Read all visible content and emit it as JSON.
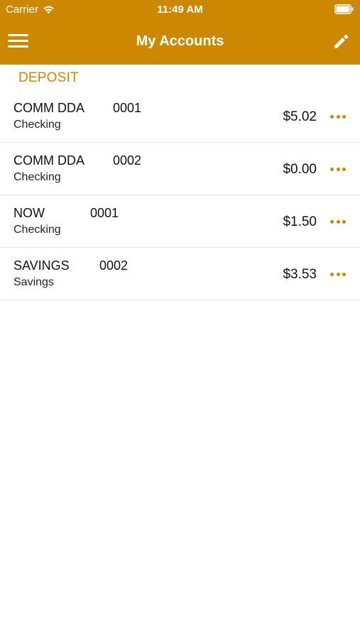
{
  "status_bar": {
    "carrier": "Carrier",
    "time": "11:49 AM"
  },
  "nav": {
    "title": "My Accounts",
    "menu_icon": "hamburger-menu-icon",
    "edit_icon": "pencil-icon"
  },
  "section": {
    "title": "DEPOSIT"
  },
  "accounts": [
    {
      "name": "COMM DDA",
      "number": "0001",
      "type": "Checking",
      "balance": "$5.02"
    },
    {
      "name": "COMM DDA",
      "number": "0002",
      "type": "Checking",
      "balance": "$0.00"
    },
    {
      "name": "NOW",
      "number": "0001",
      "type": "Checking",
      "balance": "$1.50"
    },
    {
      "name": "SAVINGS",
      "number": "0002",
      "type": "Savings",
      "balance": "$3.53"
    }
  ],
  "colors": {
    "accent": "#cc8800",
    "background": "#ffffff",
    "divider": "#e6e6e6"
  }
}
